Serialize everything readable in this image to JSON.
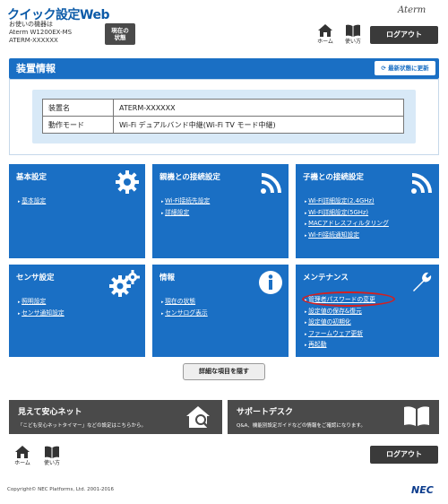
{
  "header": {
    "title": "クイック設定Web",
    "device_lines": [
      "お使いの機器は",
      "Aterm W1200EX-MS",
      "ATERM-XXXXXX"
    ],
    "status_button": [
      "現在の",
      "状態"
    ],
    "brand": "Aterm",
    "home_label": "ホーム",
    "help_label": "使い方",
    "logout_label": "ログアウト"
  },
  "device_info": {
    "heading": "装置情報",
    "refresh_label": "最新状態に更新",
    "rows": [
      {
        "key": "装置名",
        "value": "ATERM-XXXXXX"
      },
      {
        "key": "動作モード",
        "value": "Wi-Fi デュアルバンド中継(Wi-Fi TV モード中継)"
      }
    ]
  },
  "tiles": {
    "basic": {
      "title": "基本設定",
      "links": [
        "基本設定"
      ]
    },
    "parent": {
      "title": "親機との接続設定",
      "links": [
        "Wi-Fi接続先設定",
        "詳細設定"
      ]
    },
    "child": {
      "title": "子機との接続設定",
      "links": [
        "Wi-Fi詳細設定(2.4GHz)",
        "Wi-Fi詳細設定(5GHz)",
        "MACアドレスフィルタリング",
        "Wi-Fi接続通知設定"
      ]
    },
    "sensor": {
      "title": "センサ設定",
      "links": [
        "照明設定",
        "センサ通知設定"
      ]
    },
    "info": {
      "title": "情報",
      "links": [
        "現在の状態",
        "センサログ表示"
      ]
    },
    "maint": {
      "title": "メンテナンス",
      "links": [
        "管理者パスワードの変更",
        "設定値の保存&復元",
        "設定値の初期化",
        "ファームウェア更新",
        "再起動"
      ]
    }
  },
  "detail_button": "詳細な項目を隠す",
  "banners": {
    "left": {
      "title": "見えて安心ネット",
      "sub": "「こども安心ネットタイマー」などの設定はこちらから。"
    },
    "right": {
      "title": "サポートデスク",
      "sub": "Q&A、機能別設定ガイドなどの情報をご確認になります。"
    }
  },
  "footer": {
    "home_label": "ホーム",
    "help_label": "使い方",
    "logout_label": "ログアウト",
    "copyright": "Copyright© NEC Platforms, Ltd. 2001-2016",
    "nec": "NEC"
  },
  "colors": {
    "tile_blue": "#1a6fc4",
    "bar_gray": "#4a4a4a",
    "highlight": "#d42020"
  }
}
